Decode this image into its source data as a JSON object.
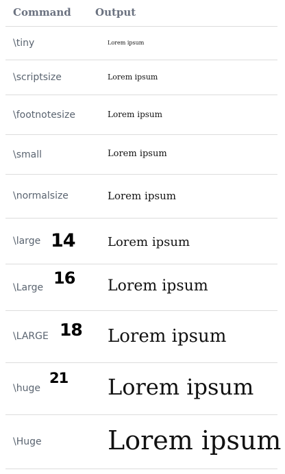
{
  "header": {
    "command": "Command",
    "output": "Output"
  },
  "rows": [
    {
      "command": "\\tiny",
      "output": "Lorem ipsum",
      "note": ""
    },
    {
      "command": "\\scriptsize",
      "output": "Lorem ipsum",
      "note": ""
    },
    {
      "command": "\\footnotesize",
      "output": "Lorem ipsum",
      "note": ""
    },
    {
      "command": "\\small",
      "output": "Lorem ipsum",
      "note": ""
    },
    {
      "command": "\\normalsize",
      "output": "Lorem ipsum",
      "note": ""
    },
    {
      "command": "\\large",
      "output": "Lorem ipsum",
      "note": "14"
    },
    {
      "command": "\\Large",
      "output": "Lorem ipsum",
      "note": "16"
    },
    {
      "command": "\\LARGE",
      "output": "Lorem ipsum",
      "note": "18"
    },
    {
      "command": "\\huge",
      "output": "Lorem ipsum",
      "note": "21"
    },
    {
      "command": "\\Huge",
      "output": "Lorem ipsum",
      "note": ""
    }
  ]
}
